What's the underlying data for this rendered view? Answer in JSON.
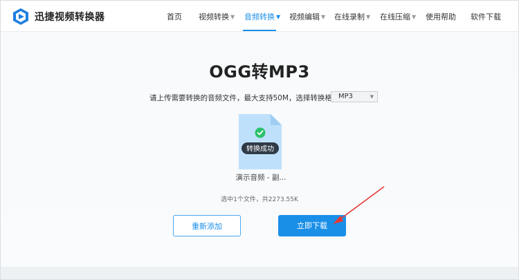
{
  "header": {
    "brand": "迅捷视频转换器",
    "nav": [
      {
        "label": "首页",
        "caret": false,
        "active": false
      },
      {
        "label": "视频转换",
        "caret": true,
        "active": false
      },
      {
        "label": "音频转换",
        "caret": true,
        "active": true
      },
      {
        "label": "视频编辑",
        "caret": true,
        "active": false
      },
      {
        "label": "在线录制",
        "caret": true,
        "active": false
      },
      {
        "label": "在线压缩",
        "caret": true,
        "active": false
      },
      {
        "label": "使用帮助",
        "caret": false,
        "active": false
      },
      {
        "label": "软件下载",
        "caret": false,
        "active": false
      }
    ]
  },
  "main": {
    "title": "OGG转MP3",
    "instruction": "请上传需要转换的音频文件，最大支持50M，选择转换格式：",
    "format_select": "MP3",
    "file": {
      "name": "演示音频 - 副...",
      "status": "转换成功"
    },
    "summary": "选中1个文件，共2273.55K",
    "readd_label": "重新添加",
    "download_label": "立即下载"
  },
  "colors": {
    "accent": "#1a8fe8",
    "success": "#2bc16b",
    "annotation_arrow": "#e53935"
  }
}
